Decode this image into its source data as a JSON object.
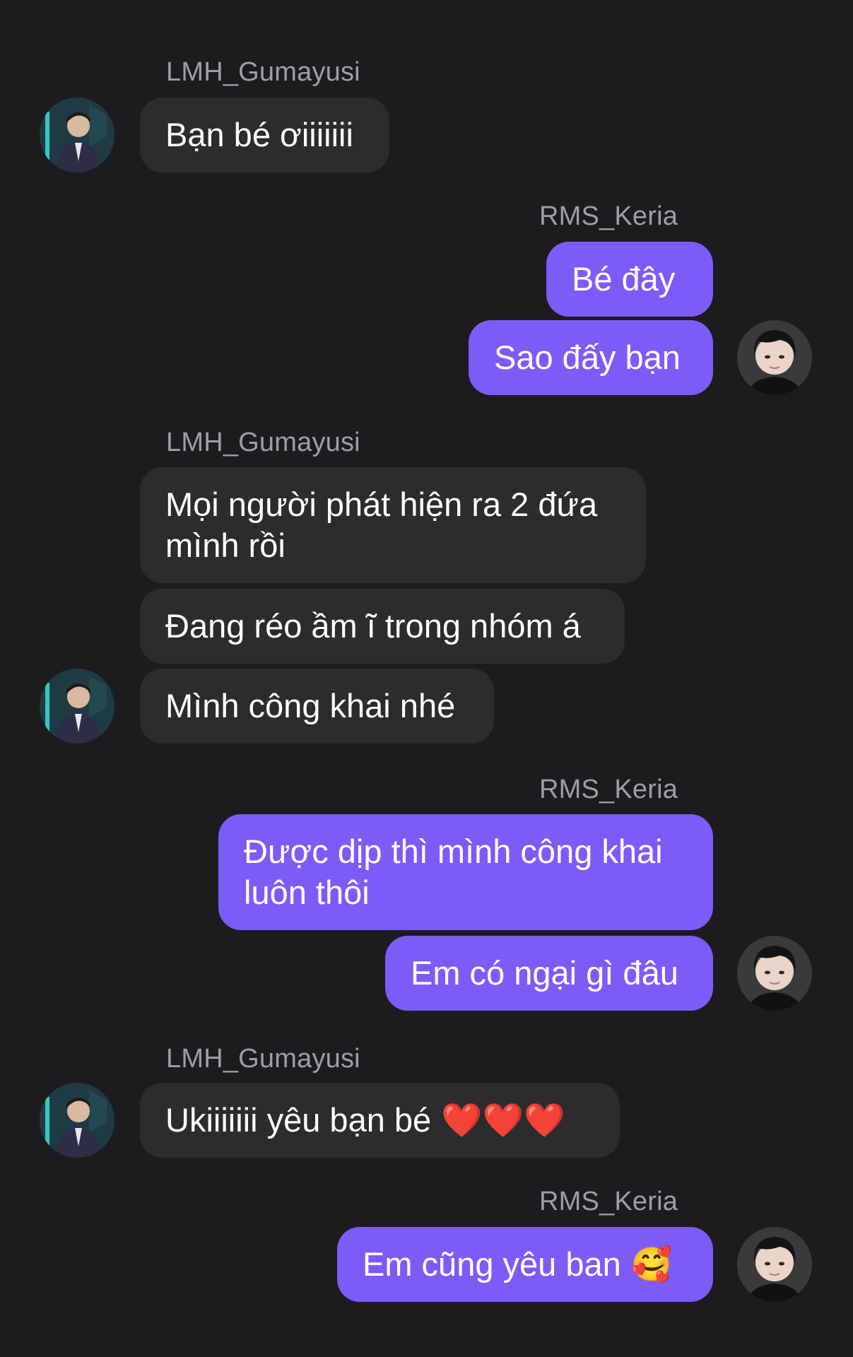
{
  "users": {
    "left": "LMH_Gumayusi",
    "right": "RMS_Keria"
  },
  "messages": [
    {
      "id": "m1",
      "text": "Bạn bé ơiiiiiii"
    },
    {
      "id": "m2",
      "text": "Bé đây"
    },
    {
      "id": "m3",
      "text": "Sao đấy bạn"
    },
    {
      "id": "m4",
      "text": "Mọi người phát hiện ra 2 đứa\nmình rồi"
    },
    {
      "id": "m5",
      "text": "Đang réo ầm ĩ trong nhóm á"
    },
    {
      "id": "m6",
      "text": "Mình công khai nhé"
    },
    {
      "id": "m7",
      "text": "Được dịp thì mình công khai\nluôn thôi"
    },
    {
      "id": "m8",
      "text": "Em có ngại gì đâu"
    },
    {
      "id": "m9",
      "text": "Ukiiiiiii yêu bạn bé",
      "emoji": "❤️❤️❤️"
    },
    {
      "id": "m10",
      "text": "Em cũng yêu ban",
      "emoji": "🥰"
    }
  ],
  "colors": {
    "background": "#1c1c1e",
    "incoming_bubble": "#2c2c2e",
    "outgoing_bubble": "#7b5cf7",
    "sender_name": "#9e9ea4"
  }
}
